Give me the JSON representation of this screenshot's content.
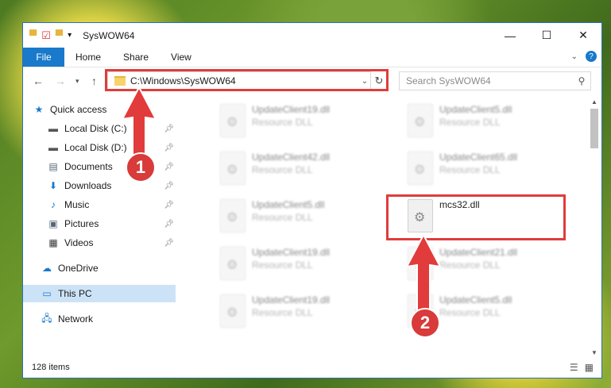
{
  "window": {
    "title": "SysWOW64"
  },
  "ribbon": {
    "tabs": [
      "File",
      "Home",
      "Share",
      "View"
    ]
  },
  "nav": {
    "address": "C:\\Windows\\SysWOW64",
    "search_placeholder": "Search SysWOW64"
  },
  "sidebar": {
    "items": [
      {
        "label": "Quick access"
      },
      {
        "label": "Local Disk (C:)"
      },
      {
        "label": "Local Disk (D:)"
      },
      {
        "label": "Documents"
      },
      {
        "label": "Downloads"
      },
      {
        "label": "Music"
      },
      {
        "label": "Pictures"
      },
      {
        "label": "Videos"
      },
      {
        "label": "OneDrive"
      },
      {
        "label": "This PC"
      },
      {
        "label": "Network"
      }
    ]
  },
  "files": [
    {
      "name": "UpdateClient19.dll",
      "type": "Resource DLL"
    },
    {
      "name": "UpdateClient5.dll",
      "type": "Resource DLL"
    },
    {
      "name": "UpdateClient42.dll",
      "type": "Resource DLL"
    },
    {
      "name": "UpdateClient65.dll",
      "type": "Resource DLL"
    },
    {
      "name": "UpdateClient5.dll",
      "type": "Resource DLL"
    },
    {
      "name": "mcs32.dll",
      "type": ""
    },
    {
      "name": "UpdateClient19.dll",
      "type": "Resource DLL"
    },
    {
      "name": "UpdateClient21.dll",
      "type": "Resource DLL"
    },
    {
      "name": "UpdateClient19.dll",
      "type": "Resource DLL"
    },
    {
      "name": "UpdateClient5.dll",
      "type": "Resource DLL"
    }
  ],
  "status": {
    "count": "128 items"
  },
  "badges": {
    "one": "1",
    "two": "2"
  },
  "colors": {
    "accent": "#1979ca",
    "highlight": "#e03c3c"
  }
}
